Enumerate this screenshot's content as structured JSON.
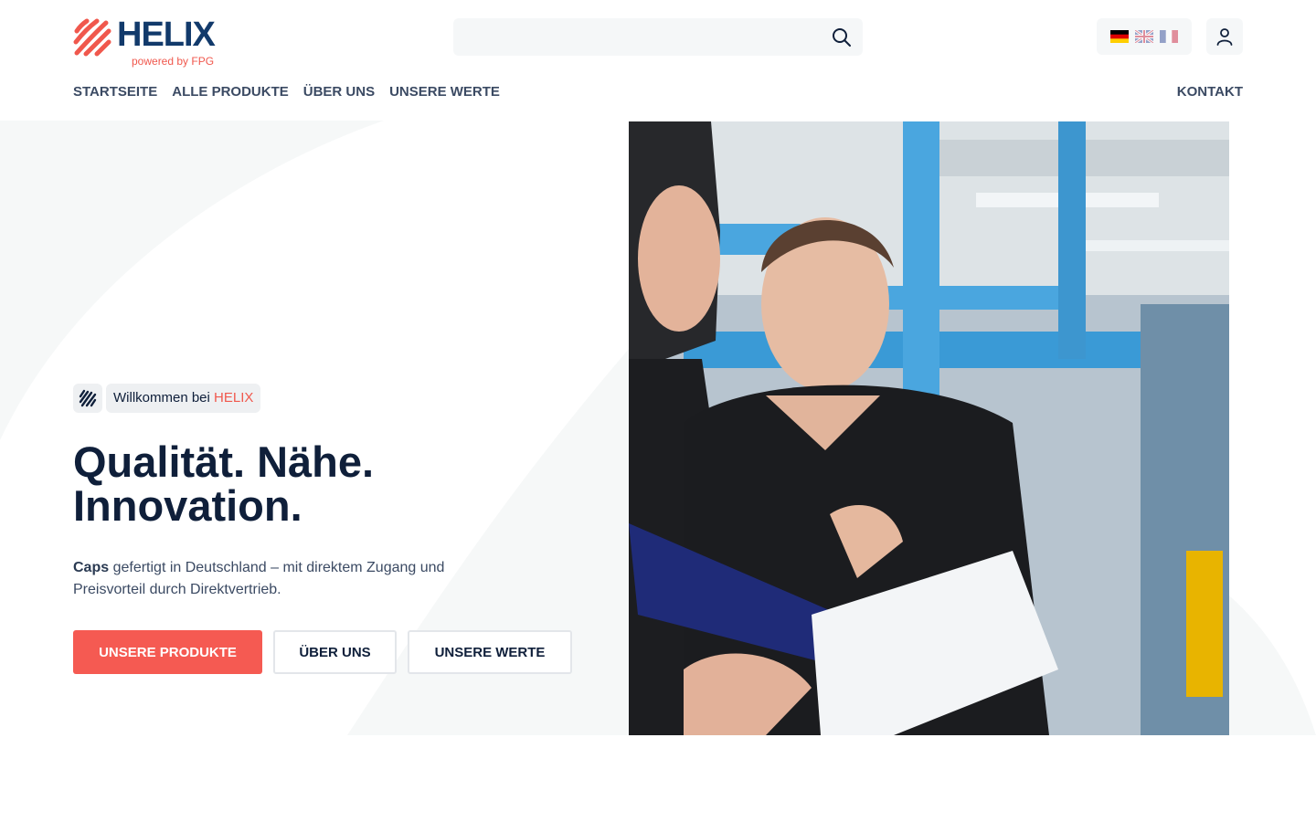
{
  "brand": {
    "name": "HELIX",
    "tagline": "powered by FPG"
  },
  "search": {
    "placeholder": ""
  },
  "languages": [
    "de",
    "en",
    "fr"
  ],
  "nav": {
    "items": [
      "STARTSEITE",
      "ALLE PRODUKTE",
      "ÜBER UNS",
      "UNSERE WERTE"
    ],
    "contact": "KONTAKT"
  },
  "hero": {
    "badge_prefix": "Willkommen bei",
    "badge_brand": "HELIX",
    "headline_line1": "Qualität. Nähe.",
    "headline_line2": "Innovation.",
    "desc_bold": "Caps",
    "desc_rest": " gefertigt in Deutschland – mit direktem Zugang und Preisvorteil durch Direktvertrieb.",
    "buttons": {
      "products": "UNSERE PRODUKTE",
      "about": "ÜBER UNS",
      "values": "UNSERE WERTE"
    }
  },
  "colors": {
    "brand_navy": "#123a6b",
    "brand_red": "#f0584d",
    "text_dark": "#0f1f3a",
    "button_primary": "#f55a52"
  },
  "icons": [
    "helix-logo-icon",
    "search-icon",
    "flag-de-icon",
    "flag-en-icon",
    "flag-fr-icon",
    "user-icon"
  ]
}
